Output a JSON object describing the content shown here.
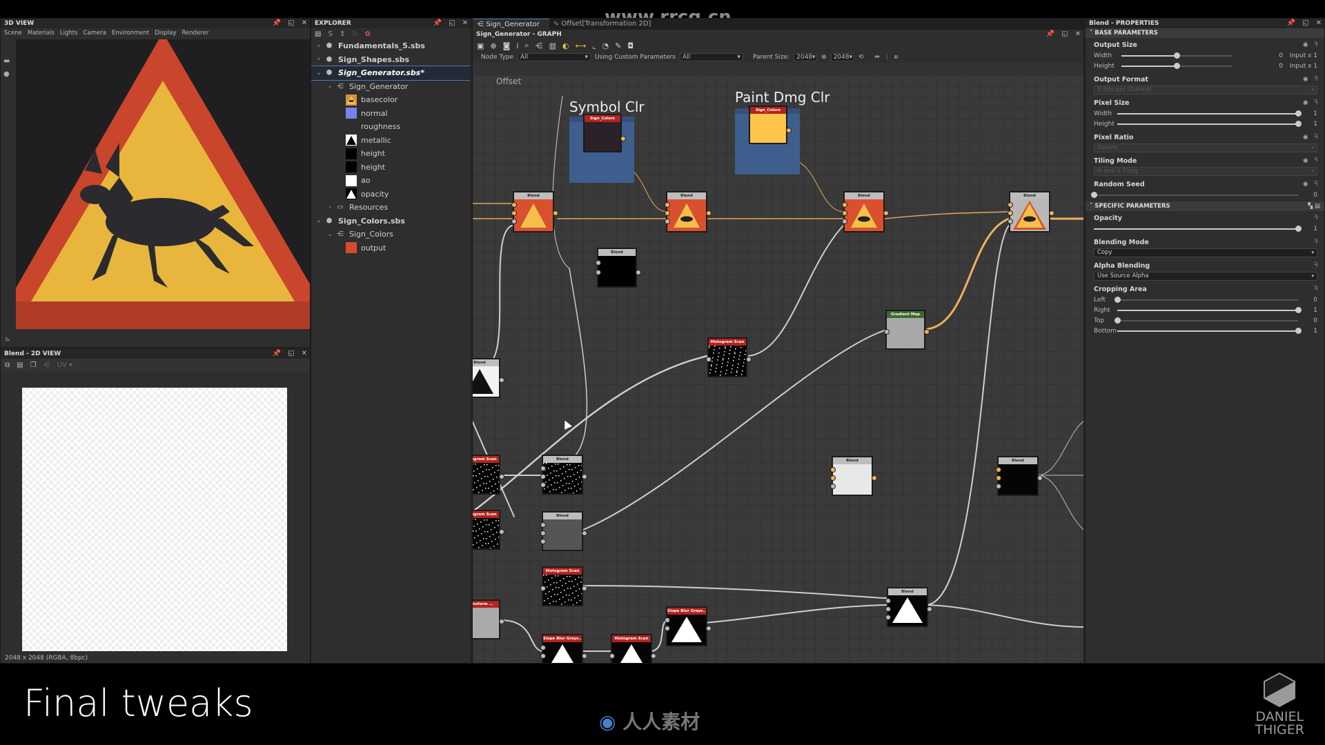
{
  "watermark_top": "www.rrcg.cn",
  "watermark_bottom": "人人素材",
  "view3d": {
    "title": "3D VIEW",
    "menu": [
      "Scene",
      "Materials",
      "Lights",
      "Camera",
      "Environment",
      "Display",
      "Renderer"
    ]
  },
  "view2d": {
    "title": "Blend - 2D VIEW",
    "uv_label": "UV",
    "status": "2048 x 2048 (RGBA, 8bpc)"
  },
  "explorer": {
    "title": "EXPLORER",
    "tree": [
      {
        "label": "Fundamentals_5.sbs",
        "level": 0,
        "expanded": false,
        "type": "package"
      },
      {
        "label": "Sign_Shapes.sbs",
        "level": 0,
        "expanded": false,
        "type": "package"
      },
      {
        "label": "Sign_Generator.sbs*",
        "level": 0,
        "expanded": true,
        "type": "package",
        "selected": true
      },
      {
        "label": "Sign_Generator",
        "level": 1,
        "expanded": true,
        "type": "graph"
      },
      {
        "label": "basecolor",
        "level": 2,
        "type": "output",
        "thumb": "sign"
      },
      {
        "label": "normal",
        "level": 2,
        "type": "output",
        "thumb": "#7a80f0"
      },
      {
        "label": "roughness",
        "level": 2,
        "type": "output",
        "thumb": "none"
      },
      {
        "label": "metallic",
        "level": 2,
        "type": "output",
        "thumb": "triangle-black"
      },
      {
        "label": "height",
        "level": 2,
        "type": "output",
        "thumb": "#000000"
      },
      {
        "label": "height",
        "level": 2,
        "type": "output",
        "thumb": "#000000"
      },
      {
        "label": "ao",
        "level": 2,
        "type": "output",
        "thumb": "#ffffff"
      },
      {
        "label": "opacity",
        "level": 2,
        "type": "output",
        "thumb": "triangle-white"
      },
      {
        "label": "Resources",
        "level": 1,
        "expanded": false,
        "type": "folder"
      },
      {
        "label": "Sign_Colors.sbs",
        "level": 0,
        "expanded": true,
        "type": "package"
      },
      {
        "label": "Sign_Colors",
        "level": 1,
        "expanded": true,
        "type": "graph"
      },
      {
        "label": "output",
        "level": 2,
        "type": "output",
        "thumb": "#d84a2a"
      }
    ]
  },
  "graph": {
    "tabs": [
      {
        "label": "Sign_Generator",
        "active": true
      },
      {
        "label": "Offset[Transformation 2D]",
        "active": false
      }
    ],
    "title": "Sign_Generator - GRAPH",
    "filters": {
      "node_type_label": "Node Type",
      "node_type_value": "All",
      "custom_params_label": "Using Custom Parameters",
      "custom_params_value": "All",
      "parent_size_label": "Parent Size:",
      "parent_size_w": "2048",
      "parent_size_h": "2048"
    },
    "offset_label": "Offset",
    "frames": [
      {
        "label": "Symbol Clr"
      },
      {
        "label": "Paint Dmg Clr"
      }
    ],
    "nodes": {
      "sign_colors_1": "Sign_Colors",
      "sign_colors_2": "Sign_Colors",
      "blend": "Blend",
      "histogram_scan": "Histogram Scan",
      "gradient_map": "Gradient Map",
      "slope_blur": "Slope Blur Grays...",
      "transform": "Transform ..."
    }
  },
  "properties": {
    "title": "Blend - PROPERTIES",
    "base_section": "BASE PARAMETERS",
    "specific_section": "SPECIFIC PARAMETERS",
    "output_size": {
      "label": "Output Size",
      "width_label": "Width",
      "width_value": "0",
      "width_mode": "Input x 1",
      "width_fraction": 0.5,
      "height_label": "Height",
      "height_value": "0",
      "height_mode": "Input x 1",
      "height_fraction": 0.5
    },
    "output_format": {
      "label": "Output Format",
      "value": "8 Bits per Channel"
    },
    "pixel_size": {
      "label": "Pixel Size",
      "width_label": "Width",
      "width_value": "1",
      "height_label": "Height",
      "height_value": "1"
    },
    "pixel_ratio": {
      "label": "Pixel Ratio",
      "value": "Square"
    },
    "tiling_mode": {
      "label": "Tiling Mode",
      "value": "H and V Tiling"
    },
    "random_seed": {
      "label": "Random Seed",
      "value": "0"
    },
    "opacity": {
      "label": "Opacity",
      "value": "1"
    },
    "blending_mode": {
      "label": "Blending Mode",
      "value": "Copy"
    },
    "alpha_blending": {
      "label": "Alpha Blending",
      "value": "Use Source Alpha"
    },
    "cropping_area": {
      "label": "Cropping Area",
      "left_label": "Left",
      "left_value": "0",
      "right_label": "Right",
      "right_value": "1",
      "top_label": "Top",
      "top_value": "0",
      "bottom_label": "Bottom",
      "bottom_value": "1"
    }
  },
  "caption": "Final tweaks",
  "logo": {
    "line1": "DANIEL",
    "line2": "THIGER"
  }
}
